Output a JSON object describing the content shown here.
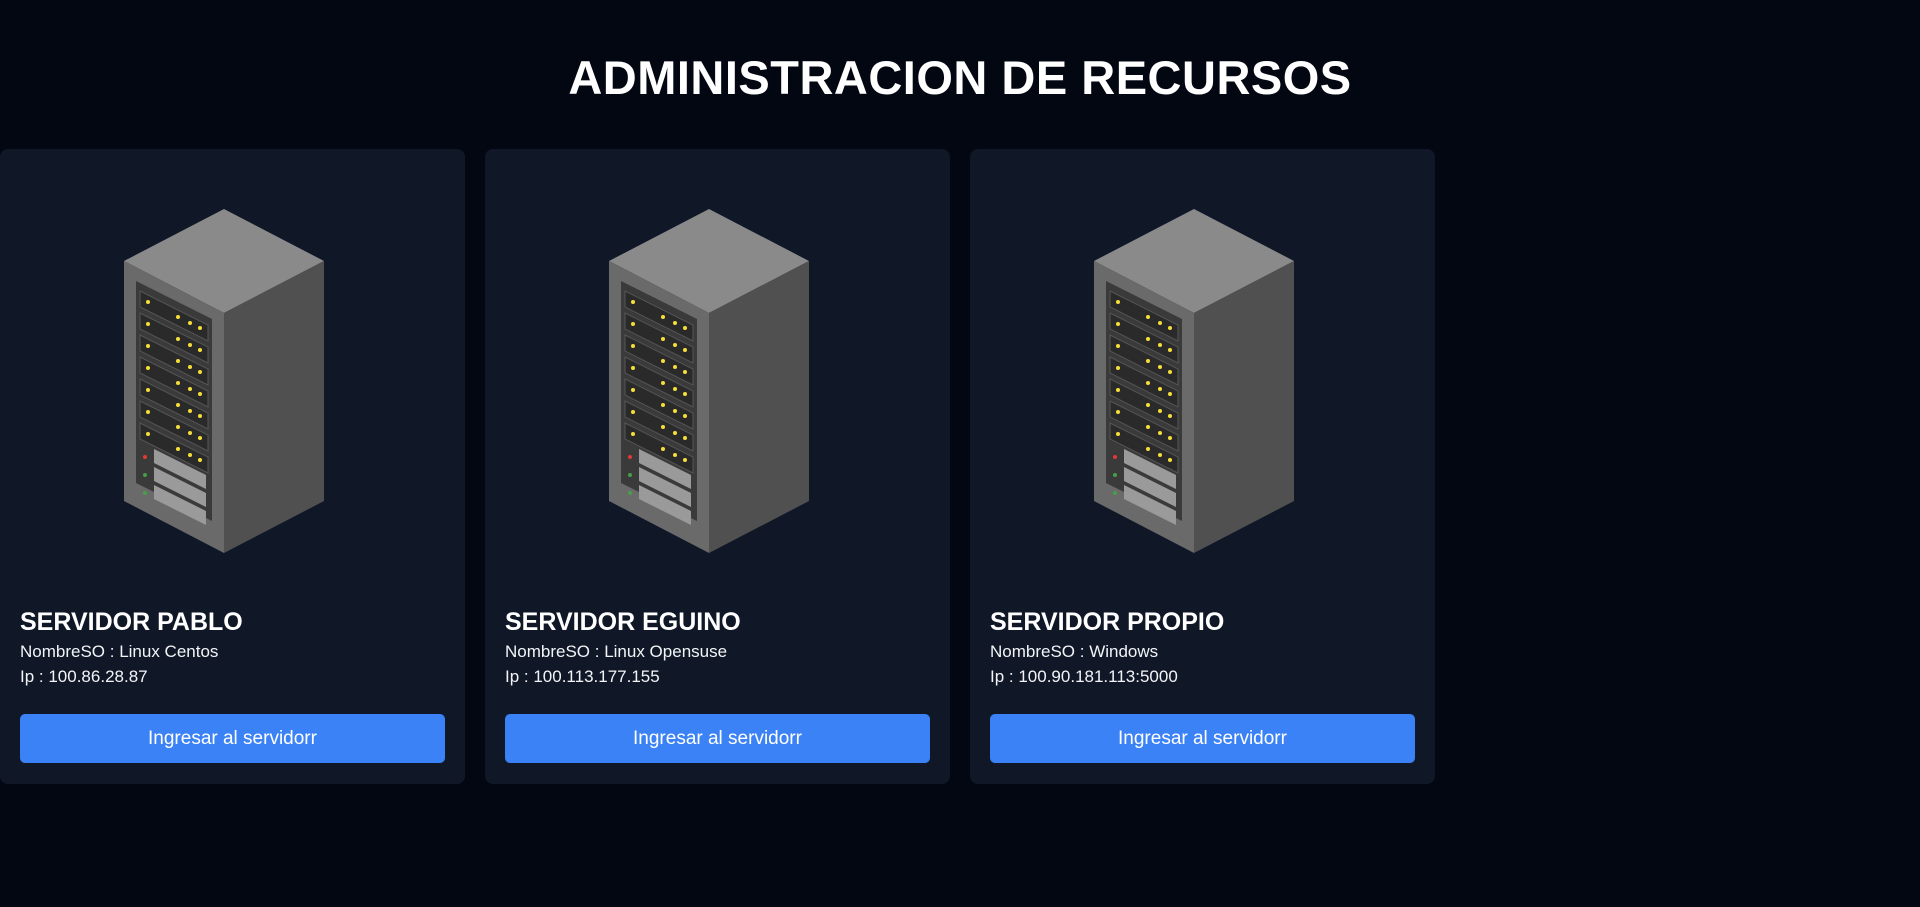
{
  "page": {
    "title": "ADMINISTRACION DE RECURSOS"
  },
  "colors": {
    "background": "#030712",
    "card": "#101828",
    "button": "#3b82f6"
  },
  "servers": [
    {
      "name": "SERVIDOR PABLO",
      "os_line": "NombreSO : Linux Centos",
      "ip_line": "Ip : 100.86.28.87",
      "button_label": "Ingresar al servidorr",
      "icon": "server-rack-icon"
    },
    {
      "name": "SERVIDOR EGUINO",
      "os_line": "NombreSO : Linux Opensuse",
      "ip_line": "Ip : 100.113.177.155",
      "button_label": "Ingresar al servidorr",
      "icon": "server-rack-icon"
    },
    {
      "name": "SERVIDOR PROPIO",
      "os_line": "NombreSO : Windows",
      "ip_line": "Ip : 100.90.181.113:5000",
      "button_label": "Ingresar al servidorr",
      "icon": "server-rack-icon"
    }
  ]
}
